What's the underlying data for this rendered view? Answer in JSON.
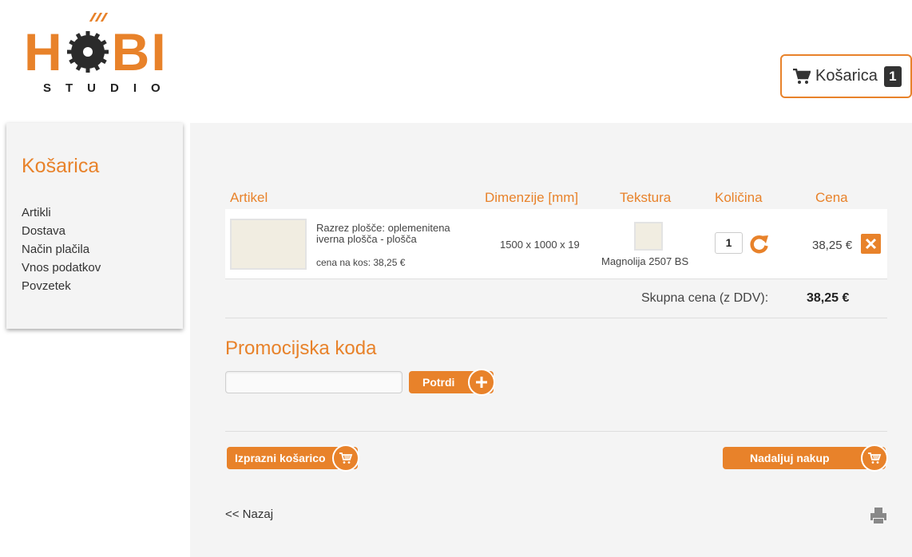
{
  "logo": {
    "left_letters": "H",
    "right_letters": "BI",
    "subtitle": "STUDIO",
    "icon": "saw-blade-icon"
  },
  "header": {
    "cart_label": "Košarica",
    "cart_count": "1",
    "cart_icon": "cart-icon"
  },
  "sidebar": {
    "title": "Košarica",
    "items": [
      {
        "label": "Artikli"
      },
      {
        "label": "Dostava"
      },
      {
        "label": "Način plačila"
      },
      {
        "label": "Vnos podatkov"
      },
      {
        "label": "Povzetek"
      }
    ]
  },
  "table": {
    "headers": {
      "article": "Artikel",
      "dimensions": "Dimenzije [mm]",
      "texture": "Tekstura",
      "quantity": "Količina",
      "price": "Cena"
    },
    "rows": [
      {
        "description": "Razrez plošče: oplemenitena iverna plošča - plošča",
        "price_each": "cena na kos: 38,25 €",
        "dimensions": "1500 x 1000 x 19",
        "texture": "Magnolija 2507 BS",
        "quantity": "1",
        "price": "38,25 €"
      }
    ],
    "total_label": "Skupna cena (z DDV):",
    "total_value": "38,25 €"
  },
  "promo": {
    "title": "Promocijska koda",
    "input_value": "",
    "submit_label": "Potrdi"
  },
  "actions": {
    "empty_cart_label": "Izprazni košarico",
    "continue_label": "Nadaljuj nakup",
    "back_label": "<< Nazaj"
  },
  "colors": {
    "accent": "#e8822a",
    "panel_bg": "#f4f4f4",
    "text": "#333333"
  }
}
